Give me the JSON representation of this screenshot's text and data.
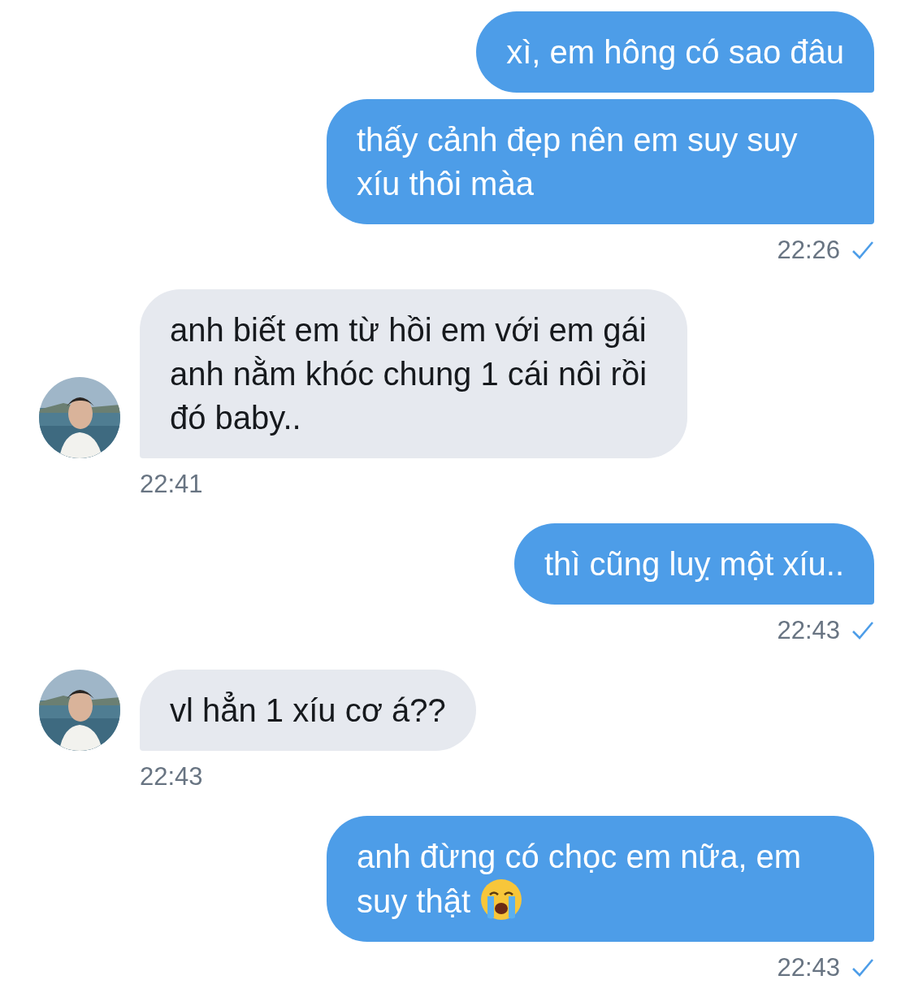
{
  "messages": [
    {
      "kind": "sent",
      "bubbles": [
        {
          "text": "xì, em hông có sao đâu"
        },
        {
          "text": "thấy cảnh đẹp nên em suy suy xíu thôi màa"
        }
      ],
      "time": "22:26",
      "read": true
    },
    {
      "kind": "received",
      "avatar": {
        "kind": "picture"
      },
      "bubbles": [
        {
          "text": "anh biết em từ hồi em với em gái anh nằm khóc chung 1 cái nôi rồi đó baby.."
        }
      ],
      "time": "22:41"
    },
    {
      "kind": "sent",
      "bubbles": [
        {
          "text": "thì cũng luỵ một xíu.."
        }
      ],
      "time": "22:43",
      "read": true
    },
    {
      "kind": "received",
      "avatar": {
        "kind": "picture"
      },
      "bubbles": [
        {
          "text": "vl hẳn 1 xíu cơ á??"
        }
      ],
      "time": "22:43"
    },
    {
      "kind": "sent",
      "bubbles": [
        {
          "text": "anh đừng có chọc em nữa, em suy thật",
          "emoji": true
        }
      ],
      "time": "22:43",
      "read": true
    }
  ]
}
